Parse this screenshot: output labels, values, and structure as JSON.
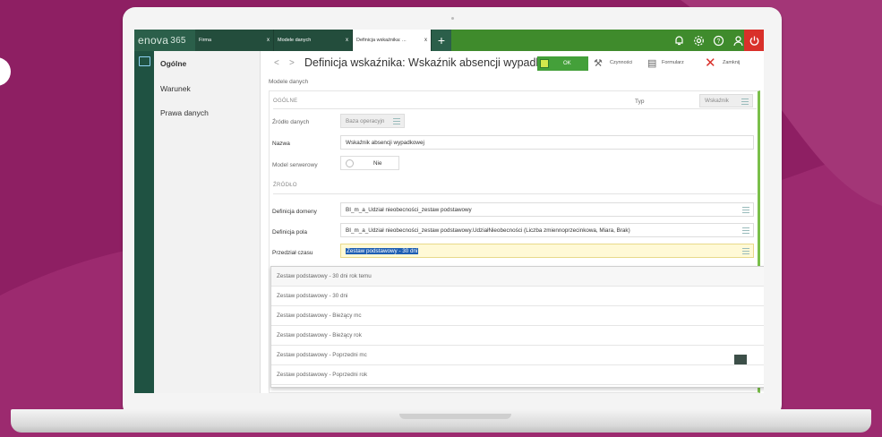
{
  "app": {
    "logo": "enova",
    "logo_num": "365"
  },
  "tabs": [
    {
      "label": "Firma",
      "close": "x"
    },
    {
      "label": "Modele danych",
      "close": "x"
    },
    {
      "label": "Definicja wskaźnika: ...",
      "close": "x"
    }
  ],
  "tab_add": "+",
  "top_icons": [
    "bell-icon",
    "gear-icon",
    "help-icon",
    "user-icon",
    "power-icon"
  ],
  "sidebar": {
    "items": [
      {
        "label": "Ogólne"
      },
      {
        "label": "Warunek"
      },
      {
        "label": "Prawa danych"
      }
    ]
  },
  "header": {
    "back": "<",
    "forward": ">",
    "title": "Definicja wskaźnika: Wskaźnik absencji wypadko...",
    "ok_label": "OK",
    "actions_label": "Czynności",
    "print_label": "Formularz",
    "close_label": "Zamknij"
  },
  "breadcrumb": "Modele danych",
  "form": {
    "section_general": "OGÓLNE",
    "type_label": "Typ",
    "type_value": "Wskaźnik",
    "source_label": "Źródło danych",
    "source_value": "Baza operacyjn",
    "name_label": "Nazwa",
    "name_value": "Wskaźnik absencji wypadkowej",
    "server_model_label": "Model serwerowy",
    "server_model_value": "Nie",
    "section_source": "ŹRÓDŁO",
    "domain_def_label": "Definicja domeny",
    "domain_def_value": "BI_m_a_Udział nieobecności_zestaw podstawowy",
    "field_def_label": "Definicja pola",
    "field_def_value": "BI_m_a_Udział nieobecności_zestaw podstawowy.UdziałNieobecności (Liczba zmiennoprzecinkowa, Miara, Brak)",
    "time_range_label": "Przedział czasu",
    "time_range_value": "Zestaw podstawowy - 30 dni"
  },
  "dropdown": {
    "options": [
      "Zestaw podstawowy - 30 dni rok temu",
      "Zestaw podstawowy - 30 dni",
      "Zestaw podstawowy - Bieżący mc",
      "Zestaw podstawowy - Bieżący rok",
      "Zestaw podstawowy - Poprzedni mc",
      "Zestaw podstawowy - Poprzedni rok"
    ]
  },
  "colors": {
    "background": "#8e1f63",
    "topbar": "#2b5f4a",
    "accent_green": "#44a03a",
    "close_red": "#d9302a"
  }
}
